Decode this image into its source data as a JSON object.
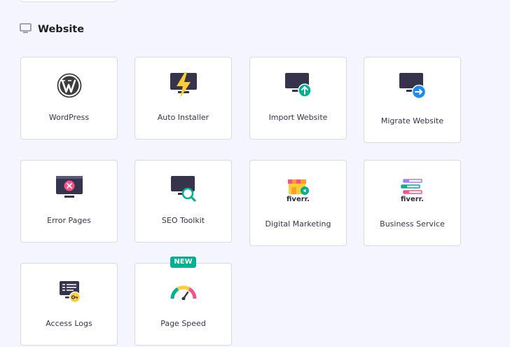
{
  "section": {
    "title": "Website",
    "icon": "monitor-icon"
  },
  "tiles": [
    {
      "label": "WordPress",
      "icon": "wordpress-icon"
    },
    {
      "label": "Auto Installer",
      "icon": "auto-installer-icon"
    },
    {
      "label": "Import Website",
      "icon": "import-website-icon"
    },
    {
      "label": "Migrate Website",
      "icon": "migrate-website-icon"
    },
    {
      "label": "Error Pages",
      "icon": "error-pages-icon"
    },
    {
      "label": "SEO Toolkit",
      "icon": "seo-toolkit-icon"
    },
    {
      "label": "Digital Marketing",
      "icon": "fiverr-storefront-icon",
      "brand": "fiverr."
    },
    {
      "label": "Business Service",
      "icon": "fiverr-list-icon",
      "brand": "fiverr."
    },
    {
      "label": "Access Logs",
      "icon": "access-logs-icon"
    },
    {
      "label": "Page Speed",
      "icon": "speedometer-icon",
      "badge": "NEW"
    }
  ],
  "colors": {
    "page_bg": "#f4f5ff",
    "accent_green": "#00b090",
    "accent_blue": "#1b8cf2",
    "accent_red": "#fc5185",
    "accent_yellow": "#ffcd35",
    "monitor_dark": "#36344d"
  }
}
